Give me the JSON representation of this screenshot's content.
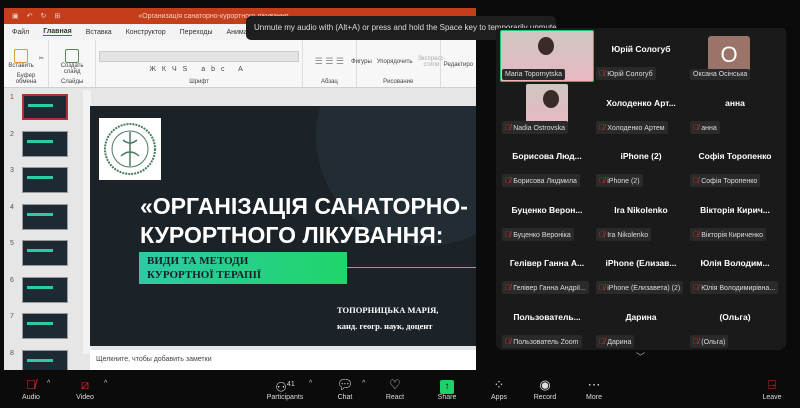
{
  "powerpoint": {
    "title": "«Организація санаторно-курортного лікування",
    "tabs": [
      "Файл",
      "Главная",
      "Вставка",
      "Конструктор",
      "Переходы",
      "Анимация"
    ],
    "active_tab": "Главная",
    "ribbon": {
      "paste": "Вставить",
      "clipboard": "Буфер обмена",
      "new_slide": "Создать слайд",
      "slides": "Слайды",
      "font": "Шрифт",
      "paragraph": "Абзац",
      "shapes": "Фигуры",
      "arrange": "Упорядочить",
      "quick_styles": "Экспресс-стили",
      "drawing": "Рисование",
      "editing": "Редактиро"
    },
    "slide_numbers": [
      "1",
      "2",
      "3",
      "4",
      "5",
      "6",
      "7",
      "8"
    ],
    "selected_slide": 1,
    "slide": {
      "title_line1": "«ОРГАНІЗАЦІЯ САНАТОРНО-",
      "title_line2": "КУРОРТНОГО ЛІКУВАННЯ:",
      "subtitle_line1": "ВИДИ ТА МЕТОДИ",
      "subtitle_line2": "КУРОРТНОЇ ТЕРАПІЇ",
      "author": "ТОПОРНИЦЬКА МАРІЯ,",
      "degree": "канд. геогр. наук, доцент",
      "accent": "#2ec9a5"
    },
    "notes_placeholder": "Щелкните, чтобы добавить заметки"
  },
  "tooltip": "Unmute my audio with (Alt+A) or press and hold the Space key to temporarily unmute.",
  "participants": [
    {
      "big": "",
      "label": "Maria Topornytska",
      "video": true,
      "muted": false,
      "active": true
    },
    {
      "big": "Юрій Сологуб",
      "label": "Юрій Сологуб",
      "muted": true
    },
    {
      "big": "O",
      "label": "Оксана Осінська",
      "avatar": true,
      "muted": false
    },
    {
      "big": "",
      "label": "Nadia Ostrovska",
      "video": true,
      "muted": true
    },
    {
      "big": "Холоденко Арт...",
      "label": "Холоденко Артем",
      "muted": true
    },
    {
      "big": "анна",
      "label": "анна",
      "muted": true
    },
    {
      "big": "Борисова Люд...",
      "label": "Борисова Людмила",
      "muted": true
    },
    {
      "big": "iPhone (2)",
      "label": "iPhone (2)",
      "muted": true
    },
    {
      "big": "Софія Торопенко",
      "label": "Софія Торопенко",
      "muted": true
    },
    {
      "big": "Буценко Верон...",
      "label": "Буценко Вероніка",
      "muted": true
    },
    {
      "big": "Ira Nikolenko",
      "label": "Ira Nikolenko",
      "muted": true
    },
    {
      "big": "Вікторія Кирич...",
      "label": "Вікторія Кириченко",
      "muted": true
    },
    {
      "big": "Гелівер Ганна А...",
      "label": "Гелівер Ганна Андрії...",
      "muted": true
    },
    {
      "big": "iPhone (Елизав...",
      "label": "iPhone (Елизавета) (2)",
      "muted": true
    },
    {
      "big": "Юлія Володим...",
      "label": "Юлія Володимирівна...",
      "muted": true
    },
    {
      "big": "Пользователь...",
      "label": "Пользователь Zoom",
      "muted": true
    },
    {
      "big": "Дарина",
      "label": "Дарина",
      "muted": true
    },
    {
      "big": "(Ольга)",
      "label": "(Ольга)",
      "muted": true
    }
  ],
  "toolbar": {
    "audio": "Audio",
    "video": "Video",
    "participants": "Participants",
    "participants_count": "41",
    "chat": "Chat",
    "react": "React",
    "share": "Share",
    "apps": "Apps",
    "record": "Record",
    "more": "More",
    "leave": "Leave",
    "share_color": "#1fd16a",
    "mute_color": "#e0322e"
  }
}
